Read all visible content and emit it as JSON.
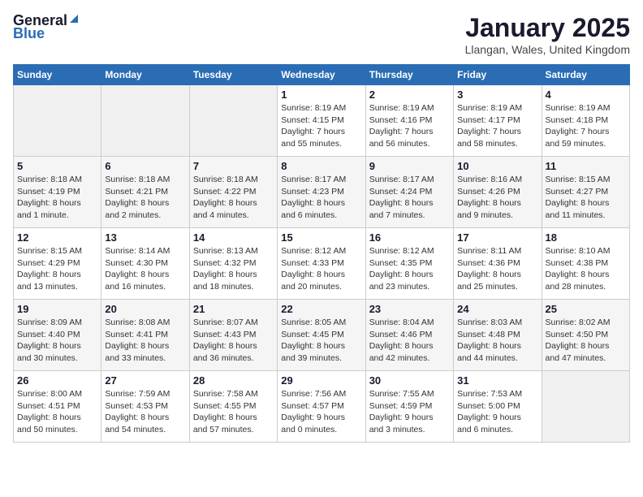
{
  "header": {
    "logo_general": "General",
    "logo_blue": "Blue",
    "month": "January 2025",
    "location": "Llangan, Wales, United Kingdom"
  },
  "weekdays": [
    "Sunday",
    "Monday",
    "Tuesday",
    "Wednesday",
    "Thursday",
    "Friday",
    "Saturday"
  ],
  "weeks": [
    [
      {
        "day": "",
        "info": ""
      },
      {
        "day": "",
        "info": ""
      },
      {
        "day": "",
        "info": ""
      },
      {
        "day": "1",
        "info": "Sunrise: 8:19 AM\nSunset: 4:15 PM\nDaylight: 7 hours\nand 55 minutes."
      },
      {
        "day": "2",
        "info": "Sunrise: 8:19 AM\nSunset: 4:16 PM\nDaylight: 7 hours\nand 56 minutes."
      },
      {
        "day": "3",
        "info": "Sunrise: 8:19 AM\nSunset: 4:17 PM\nDaylight: 7 hours\nand 58 minutes."
      },
      {
        "day": "4",
        "info": "Sunrise: 8:19 AM\nSunset: 4:18 PM\nDaylight: 7 hours\nand 59 minutes."
      }
    ],
    [
      {
        "day": "5",
        "info": "Sunrise: 8:18 AM\nSunset: 4:19 PM\nDaylight: 8 hours\nand 1 minute."
      },
      {
        "day": "6",
        "info": "Sunrise: 8:18 AM\nSunset: 4:21 PM\nDaylight: 8 hours\nand 2 minutes."
      },
      {
        "day": "7",
        "info": "Sunrise: 8:18 AM\nSunset: 4:22 PM\nDaylight: 8 hours\nand 4 minutes."
      },
      {
        "day": "8",
        "info": "Sunrise: 8:17 AM\nSunset: 4:23 PM\nDaylight: 8 hours\nand 6 minutes."
      },
      {
        "day": "9",
        "info": "Sunrise: 8:17 AM\nSunset: 4:24 PM\nDaylight: 8 hours\nand 7 minutes."
      },
      {
        "day": "10",
        "info": "Sunrise: 8:16 AM\nSunset: 4:26 PM\nDaylight: 8 hours\nand 9 minutes."
      },
      {
        "day": "11",
        "info": "Sunrise: 8:15 AM\nSunset: 4:27 PM\nDaylight: 8 hours\nand 11 minutes."
      }
    ],
    [
      {
        "day": "12",
        "info": "Sunrise: 8:15 AM\nSunset: 4:29 PM\nDaylight: 8 hours\nand 13 minutes."
      },
      {
        "day": "13",
        "info": "Sunrise: 8:14 AM\nSunset: 4:30 PM\nDaylight: 8 hours\nand 16 minutes."
      },
      {
        "day": "14",
        "info": "Sunrise: 8:13 AM\nSunset: 4:32 PM\nDaylight: 8 hours\nand 18 minutes."
      },
      {
        "day": "15",
        "info": "Sunrise: 8:12 AM\nSunset: 4:33 PM\nDaylight: 8 hours\nand 20 minutes."
      },
      {
        "day": "16",
        "info": "Sunrise: 8:12 AM\nSunset: 4:35 PM\nDaylight: 8 hours\nand 23 minutes."
      },
      {
        "day": "17",
        "info": "Sunrise: 8:11 AM\nSunset: 4:36 PM\nDaylight: 8 hours\nand 25 minutes."
      },
      {
        "day": "18",
        "info": "Sunrise: 8:10 AM\nSunset: 4:38 PM\nDaylight: 8 hours\nand 28 minutes."
      }
    ],
    [
      {
        "day": "19",
        "info": "Sunrise: 8:09 AM\nSunset: 4:40 PM\nDaylight: 8 hours\nand 30 minutes."
      },
      {
        "day": "20",
        "info": "Sunrise: 8:08 AM\nSunset: 4:41 PM\nDaylight: 8 hours\nand 33 minutes."
      },
      {
        "day": "21",
        "info": "Sunrise: 8:07 AM\nSunset: 4:43 PM\nDaylight: 8 hours\nand 36 minutes."
      },
      {
        "day": "22",
        "info": "Sunrise: 8:05 AM\nSunset: 4:45 PM\nDaylight: 8 hours\nand 39 minutes."
      },
      {
        "day": "23",
        "info": "Sunrise: 8:04 AM\nSunset: 4:46 PM\nDaylight: 8 hours\nand 42 minutes."
      },
      {
        "day": "24",
        "info": "Sunrise: 8:03 AM\nSunset: 4:48 PM\nDaylight: 8 hours\nand 44 minutes."
      },
      {
        "day": "25",
        "info": "Sunrise: 8:02 AM\nSunset: 4:50 PM\nDaylight: 8 hours\nand 47 minutes."
      }
    ],
    [
      {
        "day": "26",
        "info": "Sunrise: 8:00 AM\nSunset: 4:51 PM\nDaylight: 8 hours\nand 50 minutes."
      },
      {
        "day": "27",
        "info": "Sunrise: 7:59 AM\nSunset: 4:53 PM\nDaylight: 8 hours\nand 54 minutes."
      },
      {
        "day": "28",
        "info": "Sunrise: 7:58 AM\nSunset: 4:55 PM\nDaylight: 8 hours\nand 57 minutes."
      },
      {
        "day": "29",
        "info": "Sunrise: 7:56 AM\nSunset: 4:57 PM\nDaylight: 9 hours\nand 0 minutes."
      },
      {
        "day": "30",
        "info": "Sunrise: 7:55 AM\nSunset: 4:59 PM\nDaylight: 9 hours\nand 3 minutes."
      },
      {
        "day": "31",
        "info": "Sunrise: 7:53 AM\nSunset: 5:00 PM\nDaylight: 9 hours\nand 6 minutes."
      },
      {
        "day": "",
        "info": ""
      }
    ]
  ]
}
